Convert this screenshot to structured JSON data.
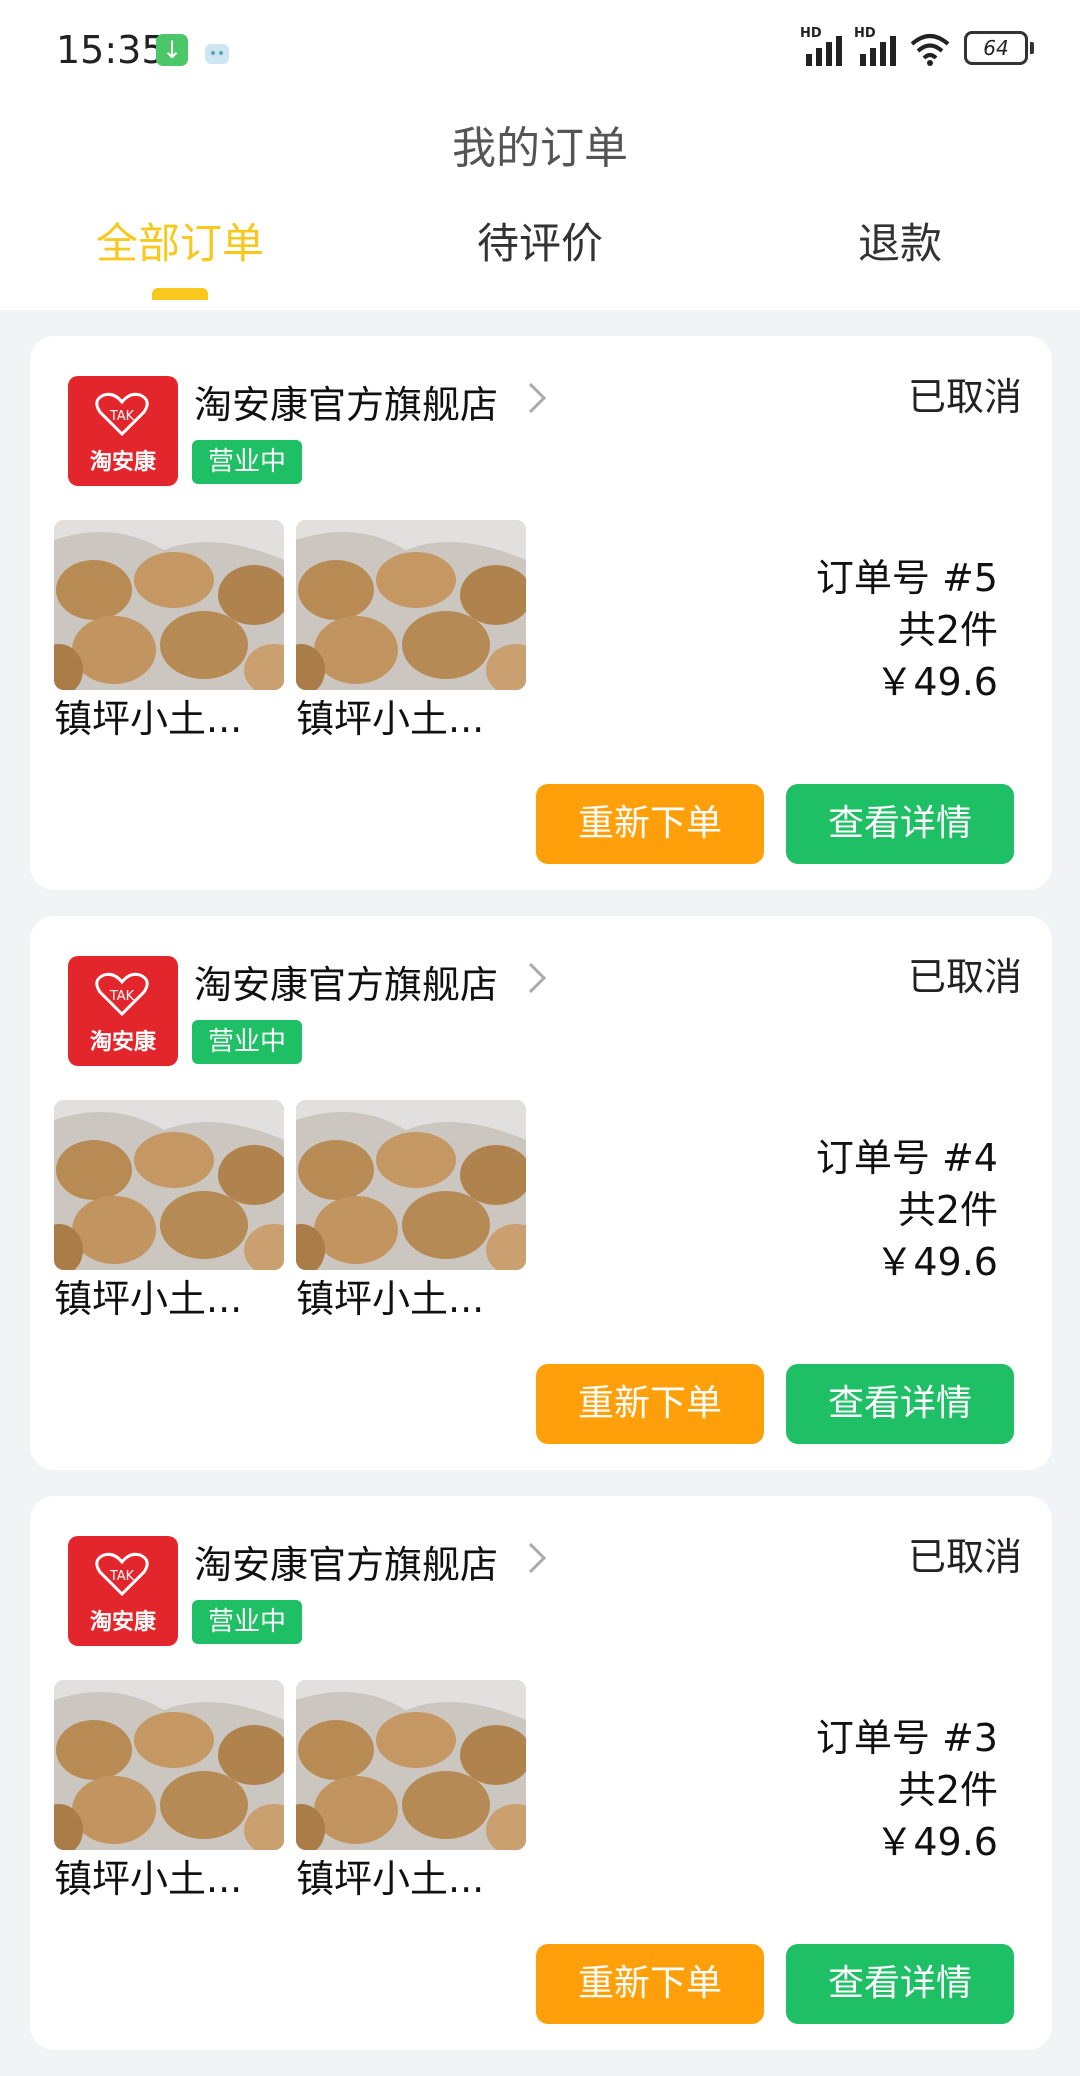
{
  "status_bar": {
    "time": "15:35",
    "network_label": "HD",
    "battery": "64"
  },
  "header": {
    "title": "我的订单",
    "tabs": [
      {
        "label": "全部订单",
        "active": true
      },
      {
        "label": "待评价",
        "active": false
      },
      {
        "label": "退款",
        "active": false
      }
    ]
  },
  "colors": {
    "accent": "#f8c81c",
    "reorder": "#ff9f0a",
    "detail": "#1fbf66",
    "logo": "#e3262c"
  },
  "orders": [
    {
      "shop_name": "淘安康官方旗舰店",
      "shop_status": "营业中",
      "logo_text": "淘安康",
      "logo_mark": "TAK",
      "order_status": "已取消",
      "order_no": "订单号 #5",
      "count": "共2件",
      "price": "￥49.6",
      "products": [
        "镇坪小土...",
        "镇坪小土..."
      ],
      "reorder_label": "重新下单",
      "detail_label": "查看详情"
    },
    {
      "shop_name": "淘安康官方旗舰店",
      "shop_status": "营业中",
      "logo_text": "淘安康",
      "logo_mark": "TAK",
      "order_status": "已取消",
      "order_no": "订单号 #4",
      "count": "共2件",
      "price": "￥49.6",
      "products": [
        "镇坪小土...",
        "镇坪小土..."
      ],
      "reorder_label": "重新下单",
      "detail_label": "查看详情"
    },
    {
      "shop_name": "淘安康官方旗舰店",
      "shop_status": "营业中",
      "logo_text": "淘安康",
      "logo_mark": "TAK",
      "order_status": "已取消",
      "order_no": "订单号 #3",
      "count": "共2件",
      "price": "￥49.6",
      "products": [
        "镇坪小土...",
        "镇坪小土..."
      ],
      "reorder_label": "重新下单",
      "detail_label": "查看详情"
    }
  ]
}
